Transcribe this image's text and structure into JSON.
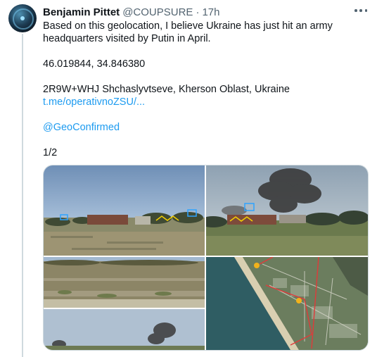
{
  "author": {
    "name": "Benjamin Pittet",
    "handle": "@COUPSURE",
    "separator": "·",
    "time": "17h"
  },
  "tweet": {
    "line1": "Based on this geolocation, I believe Ukraine has just hit an army",
    "line2": "headquarters visited by Putin in April.",
    "coordinates": "46.019844, 34.846380",
    "plus_code": "2R9W+WHJ Shchaslyvtseve, Kherson Oblast, Ukraine",
    "link": "t.me/operativnoZSU/...",
    "mention": "@GeoConfirmed",
    "counter": "1/2"
  },
  "media": {
    "count": 4,
    "photos": [
      {
        "name": "photo-1",
        "description_icon": "landscape-icon"
      },
      {
        "name": "photo-2",
        "description_icon": "smoke-icon"
      },
      {
        "name": "photo-3",
        "description_icon": "landscape-icon"
      },
      {
        "name": "photo-4",
        "description_icon": "map-icon"
      }
    ]
  },
  "colors": {
    "link": "#1d9bf0",
    "text": "#0f1419",
    "secondary": "#536471",
    "border": "#cfd9de"
  }
}
